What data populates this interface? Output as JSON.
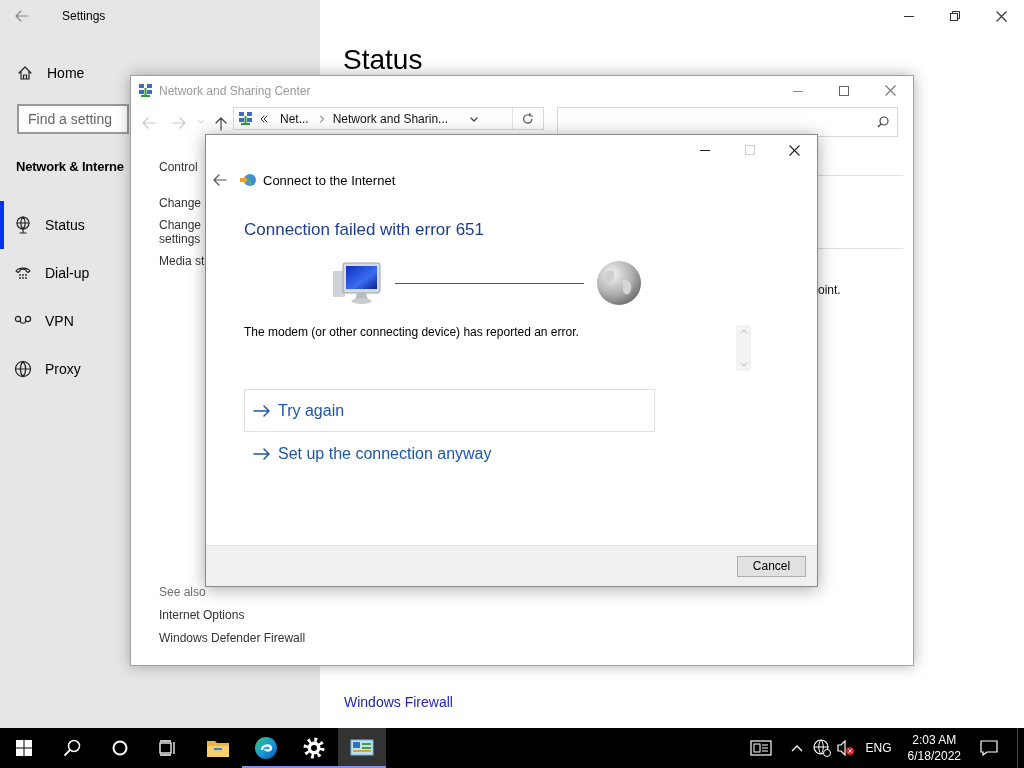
{
  "settings_window": {
    "title": "Settings",
    "home": "Home",
    "search": {
      "placeholder": "Find a setting"
    },
    "section": "Network & Interne",
    "items": [
      {
        "label": "Status",
        "kind": "status",
        "selected": true
      },
      {
        "label": "Dial-up",
        "kind": "dialup",
        "selected": false
      },
      {
        "label": "VPN",
        "kind": "vpn",
        "selected": false
      },
      {
        "label": "Proxy",
        "kind": "proxy",
        "selected": false
      }
    ],
    "heading": "Status",
    "link": "Windows Firewall"
  },
  "network_window": {
    "title": "Network and Sharing Center",
    "breadcrumb": [
      "Net...",
      "Network and Sharin..."
    ],
    "sidebar": [
      "Control",
      "Change",
      "Change\nsettings",
      "Media st"
    ],
    "see_also": {
      "title": "See also",
      "links": [
        "Internet Options",
        "Windows Defender Firewall"
      ]
    },
    "content_fragment": "oint."
  },
  "dialog": {
    "title": "Connect to the Internet",
    "heading": "Connection failed with error 651",
    "message": "The modem (or other connecting device) has reported an error.",
    "options": [
      {
        "label": "Try again",
        "selected": true
      },
      {
        "label": "Set up the connection anyway",
        "selected": false
      }
    ],
    "cancel": "Cancel"
  },
  "taskbar": {
    "apps": [
      {
        "kind": "explorer",
        "running": false,
        "active": false
      },
      {
        "kind": "edge",
        "running": true,
        "active": false
      },
      {
        "kind": "settings",
        "running": true,
        "active": false
      },
      {
        "kind": "network",
        "running": true,
        "active": true
      }
    ],
    "language": "ENG",
    "time": "2:03 AM",
    "date": "6/18/2022"
  }
}
